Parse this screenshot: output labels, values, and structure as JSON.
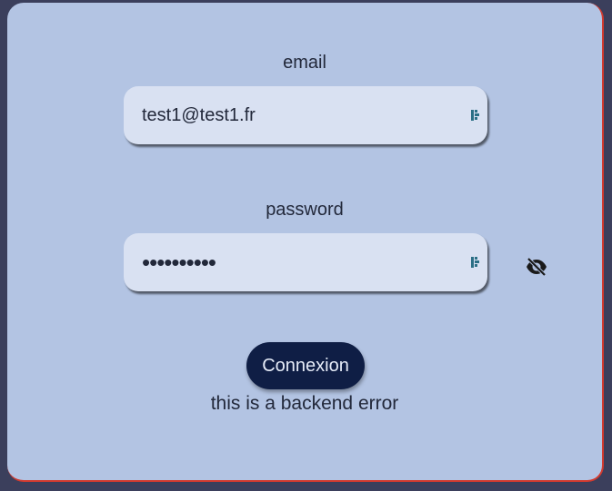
{
  "form": {
    "email": {
      "label": "email",
      "value": "test1@test1.fr"
    },
    "password": {
      "label": "password",
      "value": "••••••••••"
    },
    "submit_label": "Connexion",
    "error_message": "this is a backend error"
  },
  "icons": {
    "autofill": "password-manager-icon",
    "visibility": "eye-off-icon"
  },
  "colors": {
    "page_background": "#3b3f5c",
    "card_background": "#b3c4e3",
    "input_background": "#d9e1f2",
    "button_background": "#0f1e45",
    "card_border_accent": "#d23a2f",
    "autofill_icon": "#2b6f86"
  }
}
